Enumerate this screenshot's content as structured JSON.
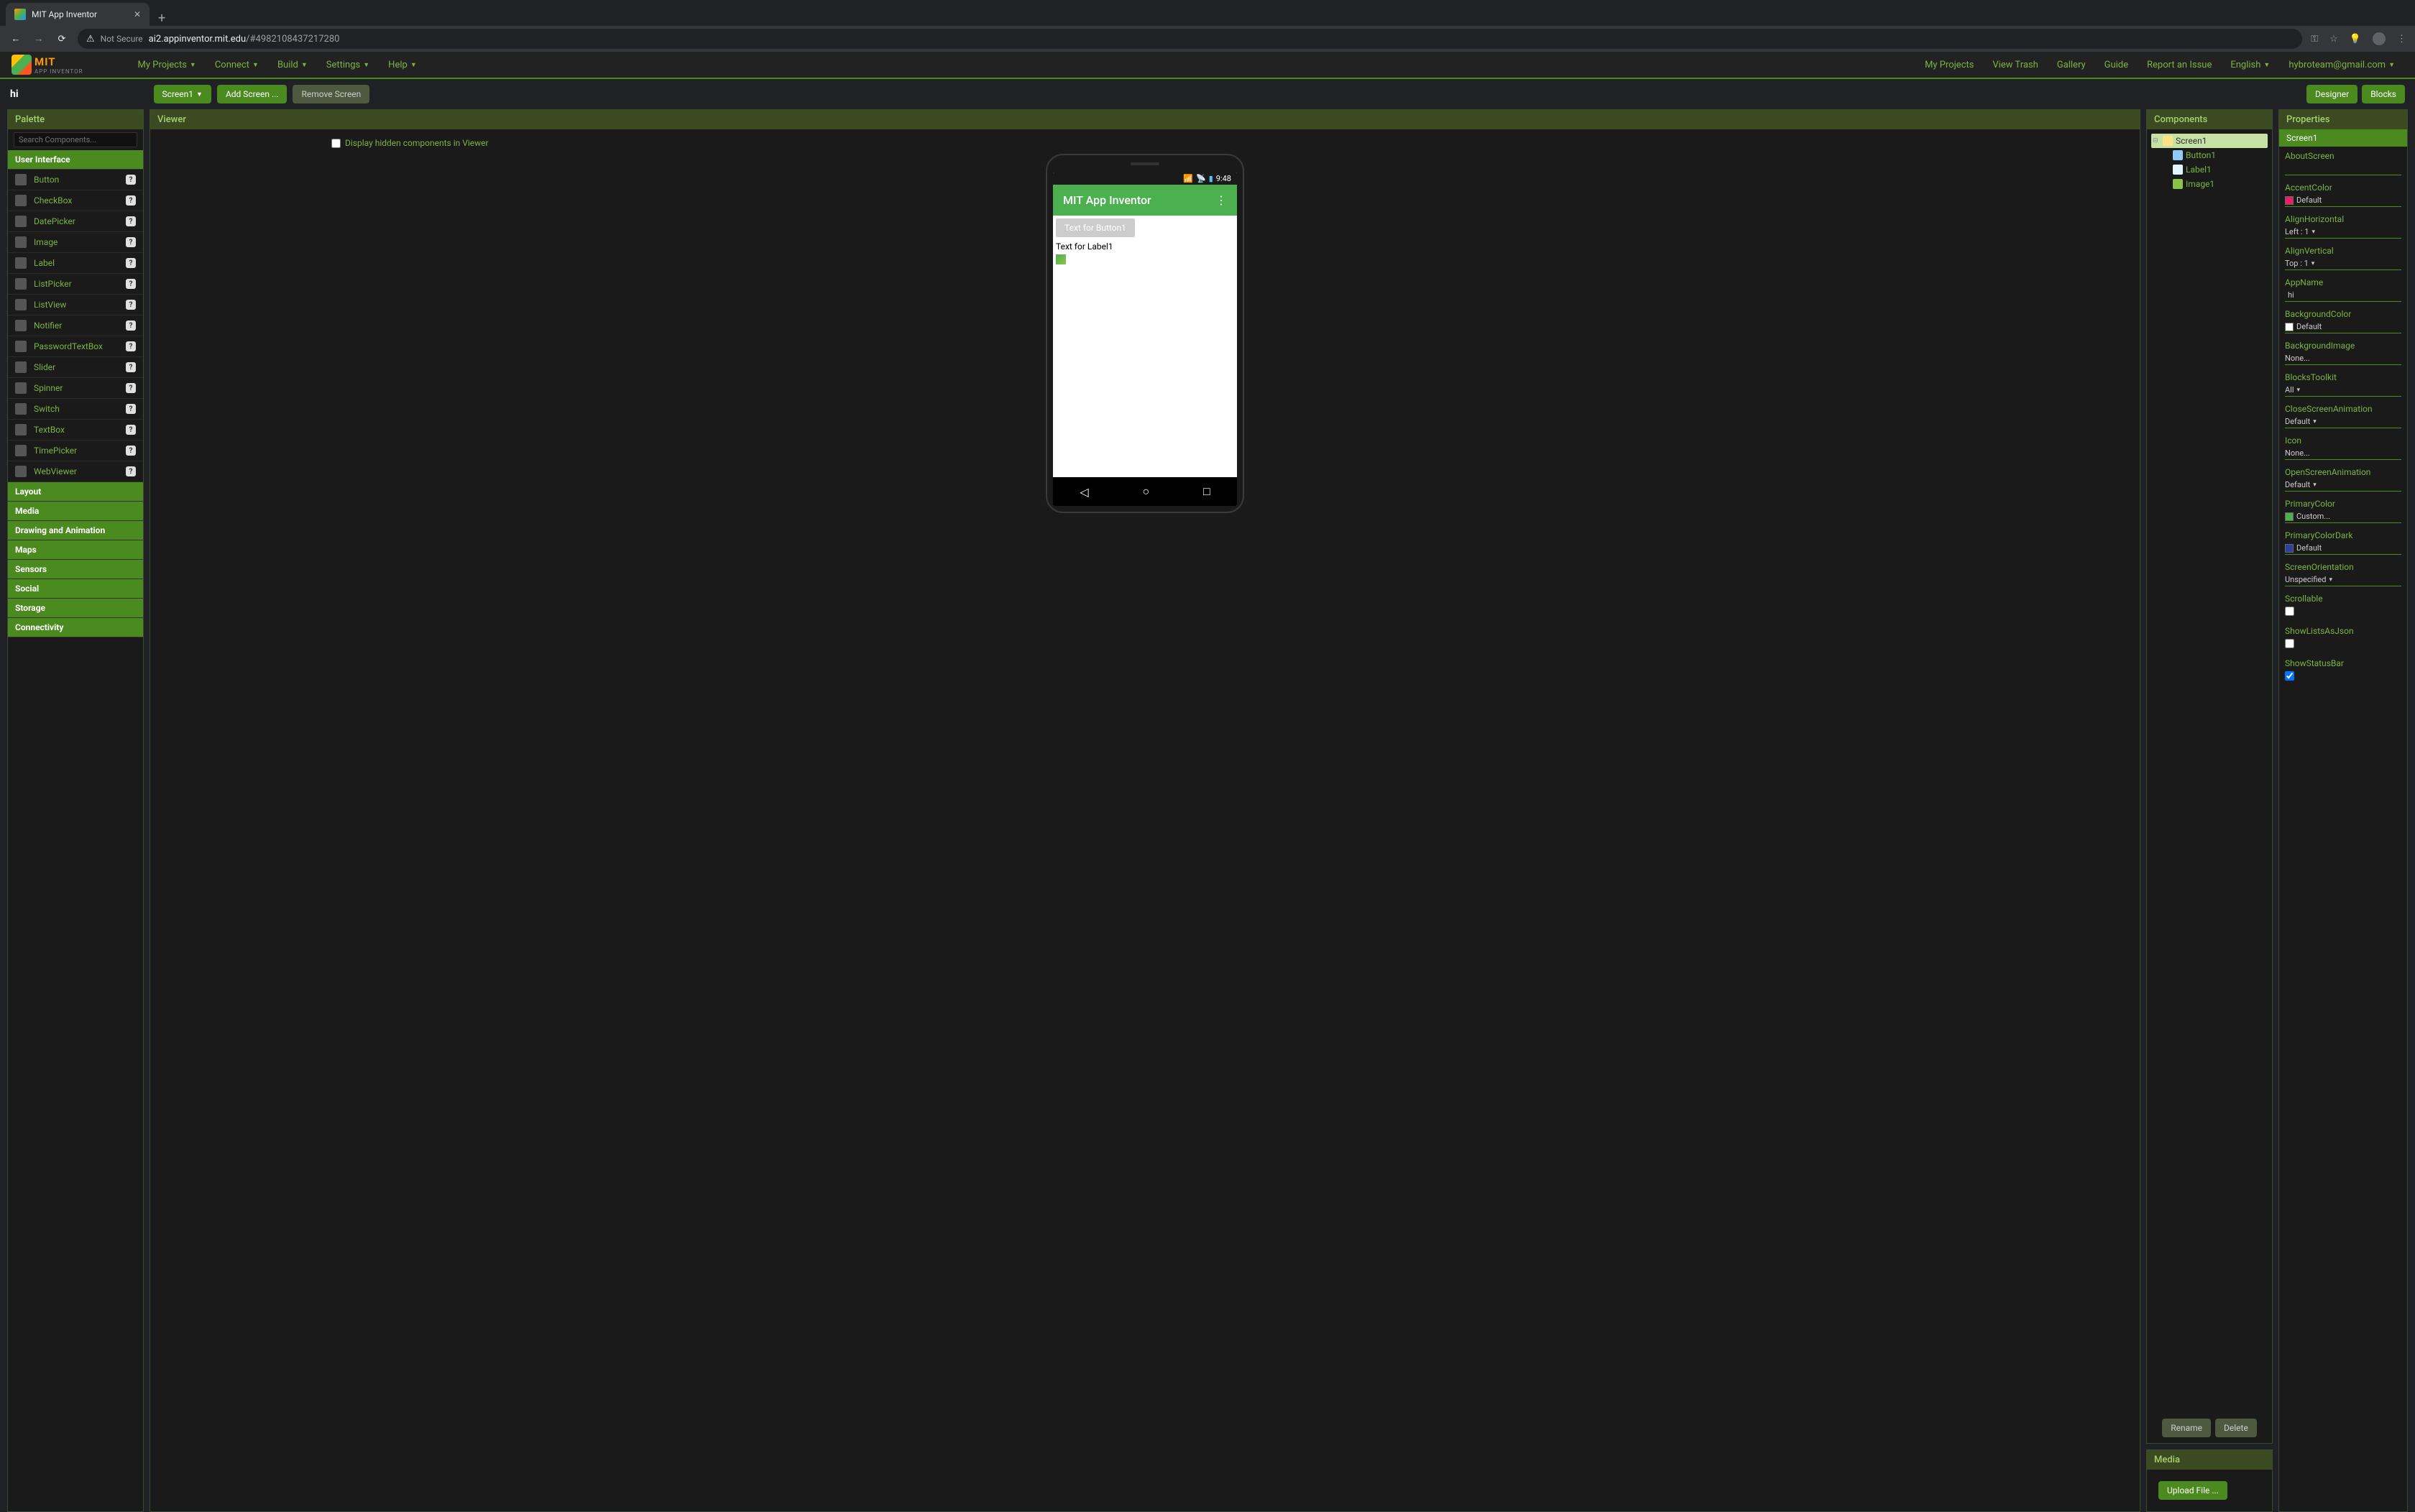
{
  "browser": {
    "tab_title": "MIT App Inventor",
    "not_secure": "Not Secure",
    "url_domain": "ai2.appinventor.mit.edu",
    "url_path": "/#4982108437217280"
  },
  "header": {
    "logo_main": "MIT",
    "logo_sub": "APP INVENTOR",
    "menu_left": [
      "My Projects",
      "Connect",
      "Build",
      "Settings",
      "Help"
    ],
    "menu_right": [
      "My Projects",
      "View Trash",
      "Gallery",
      "Guide",
      "Report an Issue",
      "English",
      "hybroteam@gmail.com"
    ]
  },
  "toolbar": {
    "project_name": "hi",
    "screen_btn": "Screen1",
    "add_screen": "Add Screen ...",
    "remove_screen": "Remove Screen",
    "designer": "Designer",
    "blocks": "Blocks"
  },
  "palette": {
    "title": "Palette",
    "search_placeholder": "Search Components...",
    "drawers": [
      "User Interface",
      "Layout",
      "Media",
      "Drawing and Animation",
      "Maps",
      "Sensors",
      "Social",
      "Storage",
      "Connectivity"
    ],
    "ui_components": [
      "Button",
      "CheckBox",
      "DatePicker",
      "Image",
      "Label",
      "ListPicker",
      "ListView",
      "Notifier",
      "PasswordTextBox",
      "Slider",
      "Spinner",
      "Switch",
      "TextBox",
      "TimePicker",
      "WebViewer"
    ]
  },
  "viewer": {
    "title": "Viewer",
    "hidden_check": "Display hidden components in Viewer",
    "status_time": "9:48",
    "app_title": "MIT App Inventor",
    "button1_text": "Text for Button1",
    "label1_text": "Text for Label1"
  },
  "components": {
    "title": "Components",
    "tree": {
      "root": "Screen1",
      "children": [
        "Button1",
        "Label1",
        "Image1"
      ]
    },
    "rename": "Rename",
    "delete": "Delete"
  },
  "media": {
    "title": "Media",
    "upload": "Upload File ..."
  },
  "properties": {
    "title": "Properties",
    "selected": "Screen1",
    "items": [
      {
        "label": "AboutScreen",
        "type": "text",
        "value": ""
      },
      {
        "label": "AccentColor",
        "type": "color",
        "value": "Default",
        "swatch": "#e91e63"
      },
      {
        "label": "AlignHorizontal",
        "type": "select",
        "value": "Left : 1"
      },
      {
        "label": "AlignVertical",
        "type": "select",
        "value": "Top : 1"
      },
      {
        "label": "AppName",
        "type": "input",
        "value": "hi"
      },
      {
        "label": "BackgroundColor",
        "type": "color",
        "value": "Default",
        "swatch": "#ffffff"
      },
      {
        "label": "BackgroundImage",
        "type": "none",
        "value": "None..."
      },
      {
        "label": "BlocksToolkit",
        "type": "select",
        "value": "All"
      },
      {
        "label": "CloseScreenAnimation",
        "type": "select",
        "value": "Default"
      },
      {
        "label": "Icon",
        "type": "none",
        "value": "None..."
      },
      {
        "label": "OpenScreenAnimation",
        "type": "select",
        "value": "Default"
      },
      {
        "label": "PrimaryColor",
        "type": "color",
        "value": "Custom...",
        "swatch": "#4caf50"
      },
      {
        "label": "PrimaryColorDark",
        "type": "color",
        "value": "Default",
        "swatch": "#303f9f"
      },
      {
        "label": "ScreenOrientation",
        "type": "select",
        "value": "Unspecified"
      },
      {
        "label": "Scrollable",
        "type": "check",
        "value": false
      },
      {
        "label": "ShowListsAsJson",
        "type": "check",
        "value": false
      },
      {
        "label": "ShowStatusBar",
        "type": "check",
        "value": true
      }
    ]
  }
}
